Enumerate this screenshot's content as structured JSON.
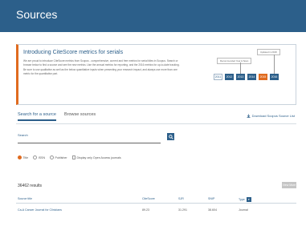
{
  "header": {
    "title": "Sources"
  },
  "banner": {
    "title": "Introducing CiteScore metrics for serials",
    "text": "We are proud to introduce CiteScore metrics from Scopus - comprehensive, current and free metrics for serial titles in Scopus. Search or browse below to find a source and see the new metrics. Use the annual metrics for reporting, and the 2016 metrics for up-to-date tracking. Be sure to use qualitative as well as the below quantitative inputs when presenting your research impact, and always use more than one metric for the quantitative part.",
    "callout_latest": "Updated in 2018",
    "callout_mid": "Recommended Year & Span",
    "years": [
      "2011",
      "2012",
      "2013",
      "2014",
      "2015",
      "2016"
    ],
    "active_year_index": 4
  },
  "tabs": [
    {
      "label": "Search for a source",
      "active": true
    },
    {
      "label": "Browse sources",
      "active": false
    }
  ],
  "download": {
    "label": "Download Scopus Source List"
  },
  "search": {
    "label": "Search",
    "value": "",
    "placeholder": ""
  },
  "filters": [
    {
      "label": "Title",
      "type": "radio",
      "checked": true
    },
    {
      "label": "ISSN",
      "type": "radio",
      "checked": false
    },
    {
      "label": "Publisher",
      "type": "radio",
      "checked": false
    },
    {
      "label": "Display only Open Access journals",
      "type": "check",
      "checked": false
    }
  ],
  "results": {
    "count": "36462 results",
    "view_button": "View More"
  },
  "table": {
    "columns": [
      "Source title",
      "CiteScore",
      "SJR",
      "SNIP",
      "Type"
    ],
    "rows": [
      [
        "Ca-A Cancer Journal for Clinicians",
        "89.23",
        "31.291",
        "38.604",
        "Journal"
      ]
    ]
  },
  "colors": {
    "brand": "#2c5f8a",
    "accent": "#e06b1f"
  }
}
